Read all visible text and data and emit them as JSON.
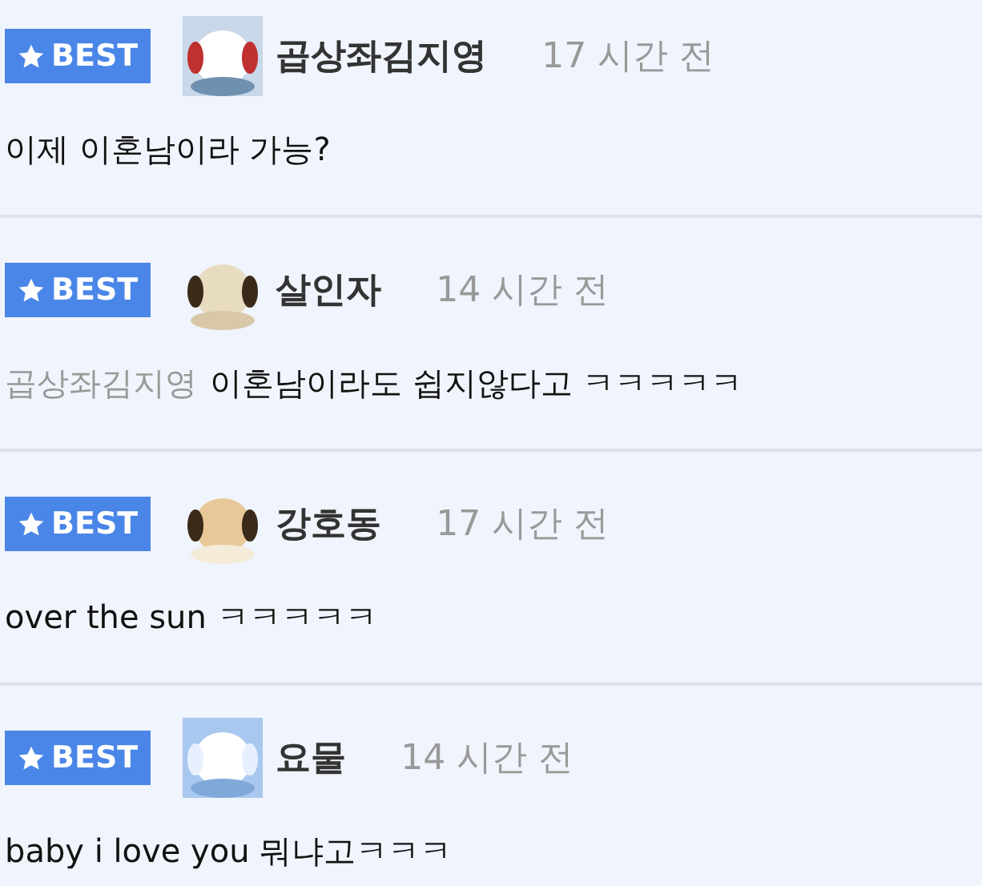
{
  "comments": [
    {
      "badge": "BEST",
      "author": "곱상좌김지영",
      "time": "17 시간 전",
      "body": "이제 이혼남이라 가능?"
    },
    {
      "badge": "BEST",
      "author": "살인자",
      "time": "14 시간 전",
      "mention": "곱상좌김지영",
      "body": "이혼남이라도 쉽지않다고 ㅋㅋㅋㅋㅋ"
    },
    {
      "badge": "BEST",
      "author": "강호동",
      "time": "17 시간 전",
      "body": "over the sun ㅋㅋㅋㅋㅋ"
    },
    {
      "badge": "BEST",
      "author": "요물",
      "time": "14 시간 전",
      "body": "baby i love you 뭐냐고ㅋㅋㅋ"
    }
  ]
}
